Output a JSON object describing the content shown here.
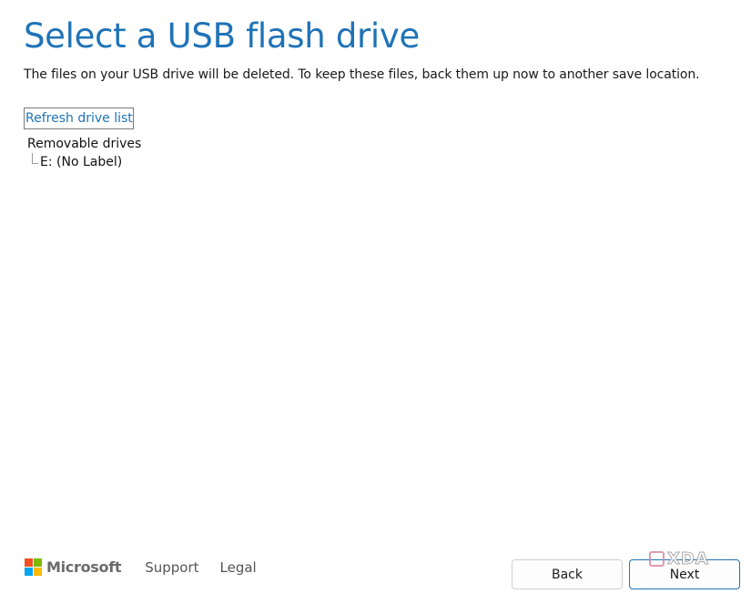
{
  "header": {
    "title": "Select a USB flash drive",
    "subtitle": "The files on your USB drive will be deleted. To keep these files, back them up now to another save location."
  },
  "refresh": {
    "label": "Refresh drive list"
  },
  "drives": {
    "group_label": "Removable drives",
    "items": [
      {
        "label": "E: (No Label)"
      }
    ]
  },
  "footer": {
    "brand": "Microsoft",
    "logo_colors": [
      "#f25022",
      "#7fba00",
      "#00a4ef",
      "#ffb900"
    ],
    "links": [
      {
        "label": "Support"
      },
      {
        "label": "Legal"
      }
    ]
  },
  "buttons": {
    "back_label": "Back",
    "next_label": "Next"
  },
  "watermark": {
    "text": "XDA"
  },
  "colors": {
    "accent": "#1f73b7"
  }
}
